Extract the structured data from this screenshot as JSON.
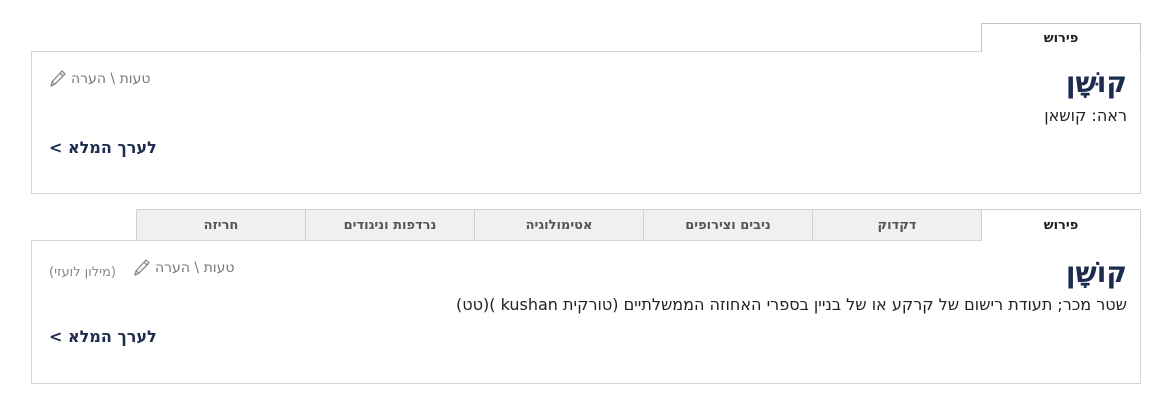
{
  "entry1": {
    "tab_label": "פירוש",
    "headword": "קוּשָׁן",
    "definition": "ראה: קושאן",
    "report_label": "טעות \\ הערה",
    "full_entry_label": "לערך המלא >"
  },
  "tabs": [
    {
      "label": "פירוש"
    },
    {
      "label": "דקדוק"
    },
    {
      "label": "ניבים וצירופים"
    },
    {
      "label": "אטימולוגיה"
    },
    {
      "label": "נרדפות וניגודים"
    },
    {
      "label": "חריזה"
    }
  ],
  "entry2": {
    "headword": "קוֹשָׁן",
    "definition": "שטר מכר; תעודת רישום של קרקע או של בניין בספרי האחוזה הממשלתיים (טורקית kushan )(טט)",
    "report_label": "טעות \\ הערה",
    "source_label": "(מילון לועזי)",
    "full_entry_label": "לערך המלא >"
  },
  "icons": {
    "report": "pencil-icon"
  },
  "colors": {
    "headword": "#1c2b4e",
    "link": "#1c2b4e",
    "border": "#d4d4d4"
  }
}
